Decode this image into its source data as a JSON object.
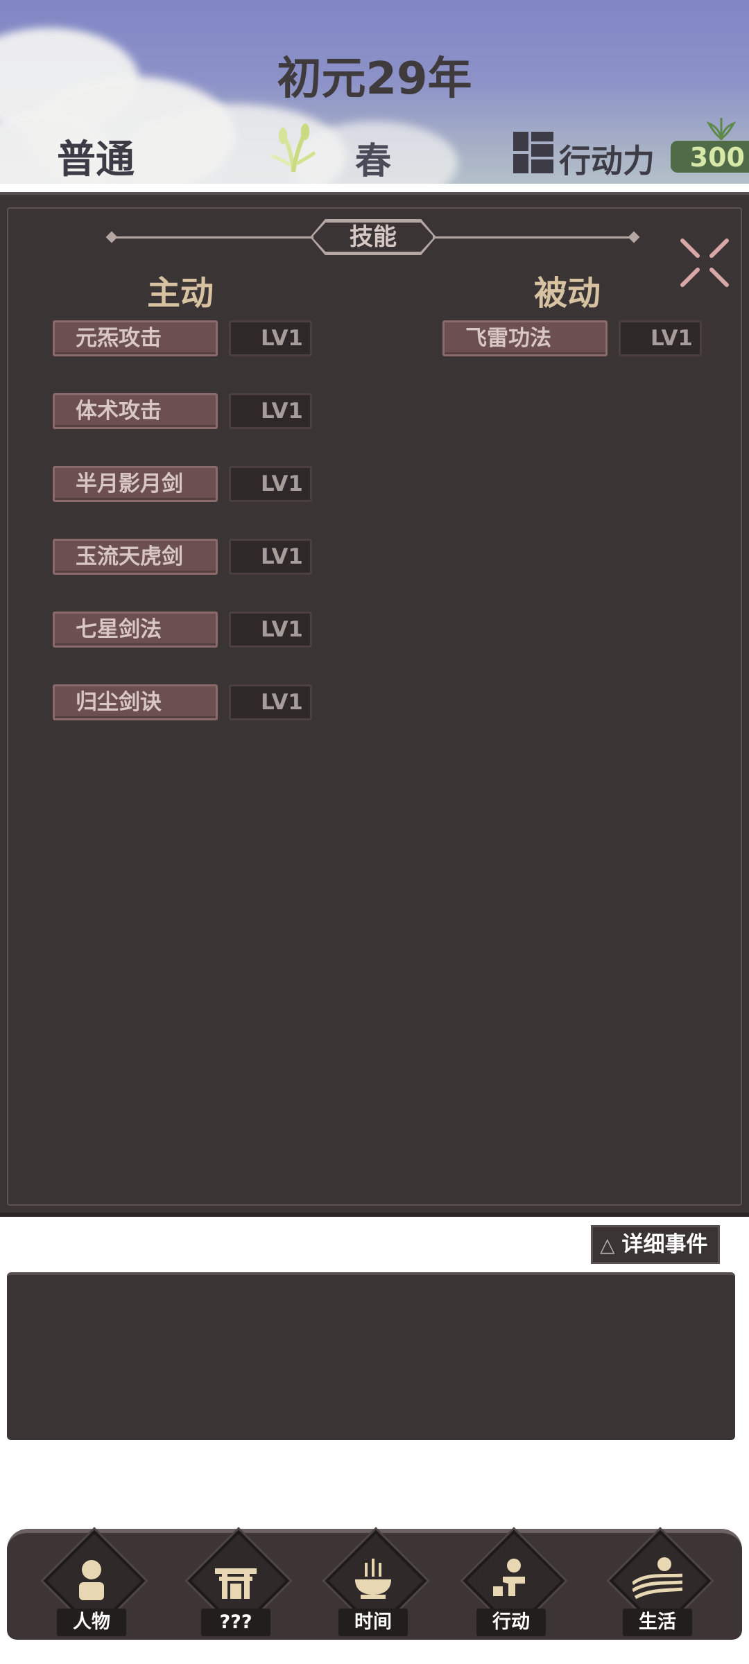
{
  "header": {
    "year_title": "初元29年",
    "difficulty": "普通",
    "season": "春",
    "action_label": "行动力",
    "action_value": "300"
  },
  "skills_panel": {
    "title": "技能",
    "active_heading": "主动",
    "passive_heading": "被动",
    "active_skills": [
      {
        "name": "元炁攻击",
        "level": "LV1"
      },
      {
        "name": "体术攻击",
        "level": "LV1"
      },
      {
        "name": "半月影月剑",
        "level": "LV1"
      },
      {
        "name": "玉流天虎剑",
        "level": "LV1"
      },
      {
        "name": "七星剑法",
        "level": "LV1"
      },
      {
        "name": "归尘剑诀",
        "level": "LV1"
      }
    ],
    "passive_skills": [
      {
        "name": "飞雷功法",
        "level": "LV1"
      }
    ]
  },
  "events": {
    "detail_button": "详细事件",
    "triangle_glyph": "△"
  },
  "bottom_nav": {
    "items": [
      {
        "label": "人物",
        "icon": "person-icon"
      },
      {
        "label": "???",
        "icon": "gate-icon"
      },
      {
        "label": "时间",
        "icon": "incense-burner-icon"
      },
      {
        "label": "行动",
        "icon": "action-figure-icon"
      },
      {
        "label": "生活",
        "icon": "field-sun-icon"
      }
    ]
  },
  "colors": {
    "panel_bg": "#3b3434",
    "skill_button": "#6b4f51",
    "heading_gold": "#d7c3a2",
    "action_green": "#4f6b48"
  }
}
